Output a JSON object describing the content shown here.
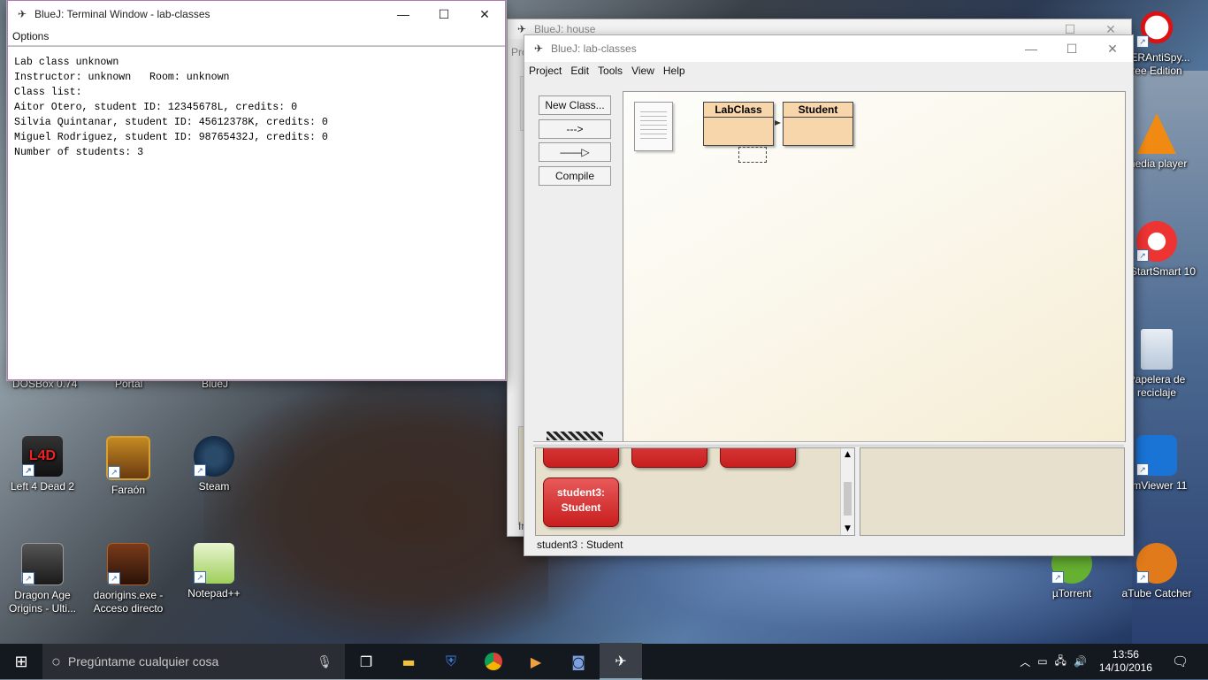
{
  "desktop": {
    "icons": [
      {
        "label": "DOSBox 0.74"
      },
      {
        "label": "Portal"
      },
      {
        "label": "BlueJ"
      },
      {
        "label": "Left 4 Dead 2"
      },
      {
        "label": "Faraón"
      },
      {
        "label": "Steam"
      },
      {
        "label": "Dragon Age Origins - Ulti..."
      },
      {
        "label": "daorigins.exe - Acceso directo"
      },
      {
        "label": "Notepad++"
      },
      {
        "label": "PERAntiSpy... ree Edition"
      },
      {
        "label": "media player"
      },
      {
        "label": "ro StartSmart 10"
      },
      {
        "label": "Papelera de reciclaje"
      },
      {
        "label": "amViewer 11"
      },
      {
        "label": "µTorrent"
      },
      {
        "label": "aTube Catcher"
      }
    ]
  },
  "terminal": {
    "title": "BlueJ: Terminal Window - lab-classes",
    "menu": [
      "Options"
    ],
    "lines": [
      "Lab class unknown",
      "Instructor: unknown   Room: unknown",
      "Class list:",
      "Aitor Otero, student ID: 12345678L, credits: 0",
      "Silvia Quintanar, student ID: 45612378K, credits: 0",
      "Miguel Rodriguez, student ID: 98765432J, credits: 0",
      "Number of students: 3"
    ]
  },
  "house_window": {
    "title": "BlueJ:  house",
    "partial_menu": "Pro",
    "partial_left": "In"
  },
  "lab_window": {
    "title": "BlueJ:  lab-classes",
    "menu": [
      "Project",
      "Edit",
      "Tools",
      "View",
      "Help"
    ],
    "buttons": {
      "new_class": "New Class...",
      "uses_arrow": "--->",
      "inherit_arrow": "——▷",
      "compile": "Compile"
    },
    "classes": [
      "LabClass",
      "Student"
    ],
    "objects": [
      {
        "name": "student3:",
        "type": "Student"
      }
    ],
    "status": "student3 : Student"
  },
  "taskbar": {
    "search_placeholder": "Pregúntame cualquier cosa",
    "time": "13:56",
    "date": "14/10/2016"
  }
}
